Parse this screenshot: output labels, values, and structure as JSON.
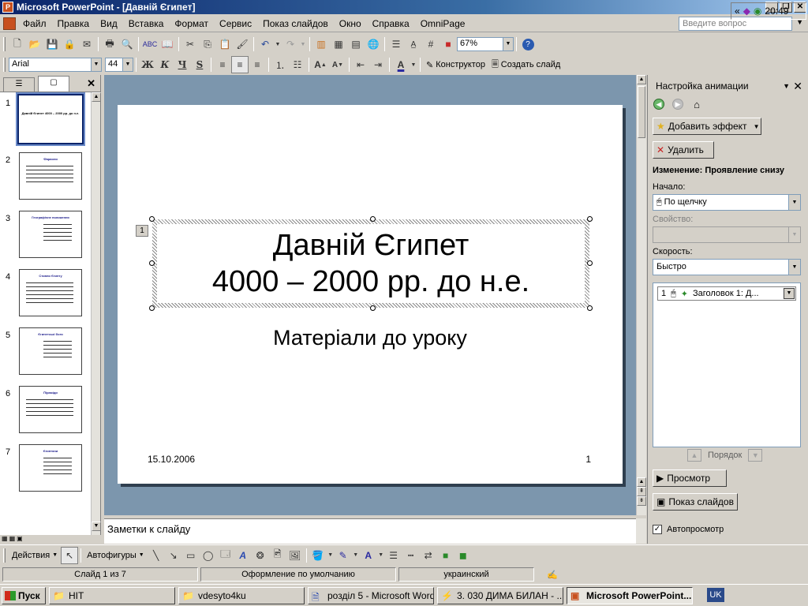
{
  "window": {
    "title": "Microsoft PowerPoint - [Давній Єгипет]",
    "app_icon": "powerpoint-icon"
  },
  "menu": {
    "items": [
      "Файл",
      "Правка",
      "Вид",
      "Вставка",
      "Формат",
      "Сервис",
      "Показ слайдов",
      "Окно",
      "Справка",
      "OmniPage"
    ],
    "help_placeholder": "Введите вопрос"
  },
  "toolbar_standard": {
    "zoom": "67%"
  },
  "toolbar_format": {
    "font": "Arial",
    "size": "44",
    "bold": "Ж",
    "italic": "К",
    "underline": "Ч",
    "shadow": "S",
    "designer_label": "Конструктор",
    "new_slide_label": "Создать слайд"
  },
  "slides_panel": {
    "thumbs": [
      {
        "num": "1",
        "title": "Давній Єгипет 4000 – 2000 рр. до н.е."
      },
      {
        "num": "2",
        "title": "Фараони"
      },
      {
        "num": "3",
        "title": "Географічне положення"
      },
      {
        "num": "4",
        "title": "Стовпи Єгипту"
      },
      {
        "num": "5",
        "title": "Єгипетські боги"
      },
      {
        "num": "6",
        "title": "Піраміди"
      },
      {
        "num": "7",
        "title": "Єгиптяни"
      }
    ]
  },
  "slide": {
    "title_line1": "Давній Єгипет",
    "title_line2": "4000 – 2000 рр. до н.е.",
    "subtitle": "Матеріали до уроку",
    "date": "15.10.2006",
    "number": "1",
    "anim_tag": "1"
  },
  "notes": {
    "placeholder": "Заметки к слайду"
  },
  "task_pane": {
    "title": "Настройка анимации",
    "add_effect": "Добавить эффект",
    "remove": "Удалить",
    "change_label": "Изменение: Проявление снизу",
    "start_label": "Начало:",
    "start_value": "По щелчку",
    "property_label": "Свойство:",
    "speed_label": "Скорость:",
    "speed_value": "Быстро",
    "anim_item_num": "1",
    "anim_item_label": "Заголовок 1: Д...",
    "order_label": "Порядок",
    "preview": "Просмотр",
    "slideshow": "Показ слайдов",
    "autopreview": "Автопросмотр",
    "autopreview_checked": true
  },
  "drawing_toolbar": {
    "actions": "Действия",
    "autoshapes": "Автофигуры"
  },
  "status": {
    "slide": "Слайд 1 из 7",
    "design": "Оформление по умолчанию",
    "language": "украинский"
  },
  "taskbar": {
    "start": "Пуск",
    "items": [
      {
        "label": "HIT",
        "icon": "folder-icon"
      },
      {
        "label": "vdesyto4ku",
        "icon": "folder-icon"
      },
      {
        "label": "розділ 5 - Microsoft Word",
        "icon": "word-icon"
      },
      {
        "label": "3. 030 ДИМА БИЛАН - ...",
        "icon": "winamp-icon"
      },
      {
        "label": "Microsoft PowerPoint...",
        "icon": "powerpoint-icon"
      }
    ],
    "lang": "UK",
    "time": "20:49"
  },
  "colors": {
    "titlebar": "#0a246a",
    "slide_bg_area": "#7c96ad",
    "chrome": "#d4d0c8"
  }
}
